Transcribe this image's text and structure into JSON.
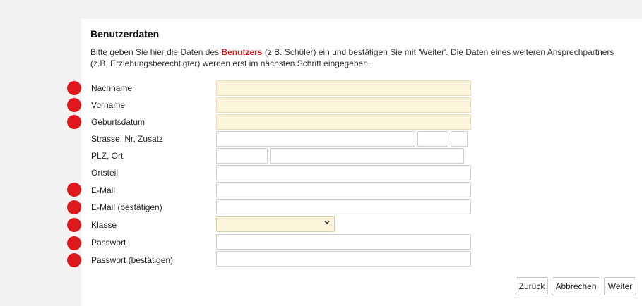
{
  "section_title": "Benutzerdaten",
  "intro": {
    "part1": "Bitte geben Sie hier die Daten des ",
    "highlight": "Benutzers",
    "part2": " (z.B. Schüler) ein und bestätigen Sie mit 'Weiter'. Die Daten eines weiteren Ansprechpartners (z.B. Erziehungsberechtigter) werden erst im nächsten Schritt eingegeben."
  },
  "fields": {
    "nachname": "Nachname",
    "vorname": "Vorname",
    "geburtsdatum": "Geburtsdatum",
    "strasse": "Strasse, Nr, Zusatz",
    "plz_ort": "PLZ, Ort",
    "ortsteil": "Ortsteil",
    "email": "E-Mail",
    "email_confirm": "E-Mail (bestätigen)",
    "klasse": "Klasse",
    "passwort": "Passwort",
    "passwort_confirm": "Passwort (bestätigen)"
  },
  "buttons": {
    "back": "Zurück",
    "cancel": "Abbrechen",
    "next": "Weiter"
  },
  "colors": {
    "required_marker": "#e0191d",
    "required_field_bg": "#fdf4dc"
  },
  "icons": {
    "required_marker": "required-dot-icon",
    "select_arrow": "chevron-down-icon"
  }
}
